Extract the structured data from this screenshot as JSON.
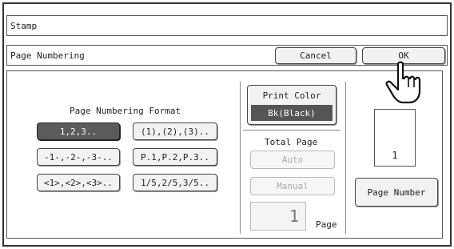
{
  "header": {
    "title": "Stamp",
    "subtitle": "Page Numbering"
  },
  "buttons": {
    "cancel": "Cancel",
    "ok": "OK"
  },
  "format": {
    "label": "Page Numbering Format",
    "options": [
      "1,2,3..",
      "(1),(2),(3)..",
      "-1-,-2-,-3-..",
      "P.1,P.2,P.3..",
      "<1>,<2>,<3>..",
      "1/5,2/5,3/5.."
    ],
    "selected": "1,2,3.."
  },
  "print_color": {
    "label": "Print Color",
    "value": "Bk(Black)"
  },
  "total_page": {
    "label": "Total Page",
    "auto": "Auto",
    "manual": "Manual",
    "value": "1",
    "unit": "Page"
  },
  "preview": {
    "page_number": "1"
  },
  "page_number_button": "Page Number",
  "icons": {
    "pointer": "pointing-hand-icon"
  }
}
